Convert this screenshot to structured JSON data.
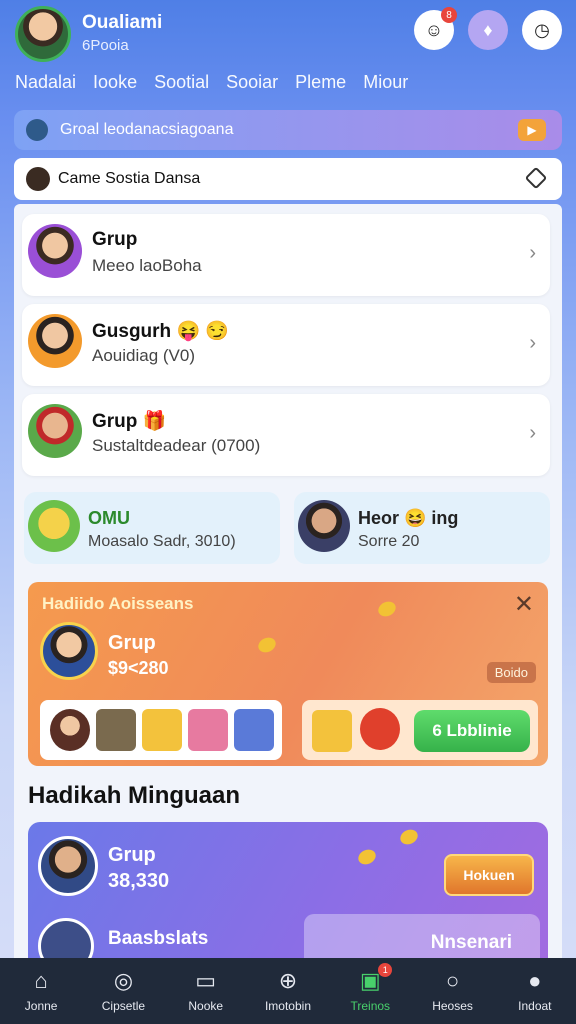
{
  "header": {
    "user_name": "Oualiami",
    "user_coins": "6Pooia",
    "notif_badge": "8"
  },
  "tabs": [
    "Nadalai",
    "Iooke",
    "Sootial",
    "Sooiar",
    "Pleme",
    "Miour"
  ],
  "banner": {
    "text": "Groal leodanacsiagoana"
  },
  "section_bar": {
    "title": "Came Sostia Dansa"
  },
  "list": [
    {
      "title": "Grup",
      "subtitle": "Meeo laoBoha"
    },
    {
      "title": "Gusgurh 😝 😏",
      "subtitle": "Aouidiag (V0)"
    },
    {
      "title": "Grup 🎁",
      "subtitle": "Sustaltdeadear (0700)"
    }
  ],
  "small_cards": [
    {
      "title": "OMU",
      "subtitle": "Moasalo Sadr, 3010)"
    },
    {
      "title": "Heor 😆 ing",
      "subtitle": "Sorre 20"
    }
  ],
  "promo": {
    "title": "Hadiido Aoisseans",
    "name": "Grup",
    "value": "$9<280",
    "tag": "Boido",
    "cta": "Lbblinie",
    "cta_num": "6"
  },
  "section_title": "Hadikah Minguaan",
  "purple_card": {
    "name": "Grup",
    "value": "38,330",
    "badge": "Hokuen",
    "name2": "Baasbslats",
    "right_text": "Nnsenari"
  },
  "bottom_nav": [
    {
      "label": "Jonne",
      "icon": "home-icon"
    },
    {
      "label": "Cipsetle",
      "icon": "compass-icon"
    },
    {
      "label": "Nooke",
      "icon": "note-icon"
    },
    {
      "label": "Imotobin",
      "icon": "plus-circle-icon"
    },
    {
      "label": "Treinos",
      "icon": "gift-icon",
      "badge": "1"
    },
    {
      "label": "Heoses",
      "icon": "user-outline-icon"
    },
    {
      "label": "Indoat",
      "icon": "profile-icon"
    }
  ],
  "colors": {
    "accent": "#48d06b",
    "header_bg": "#4f7fe6",
    "nav_bg": "#202a3a"
  }
}
